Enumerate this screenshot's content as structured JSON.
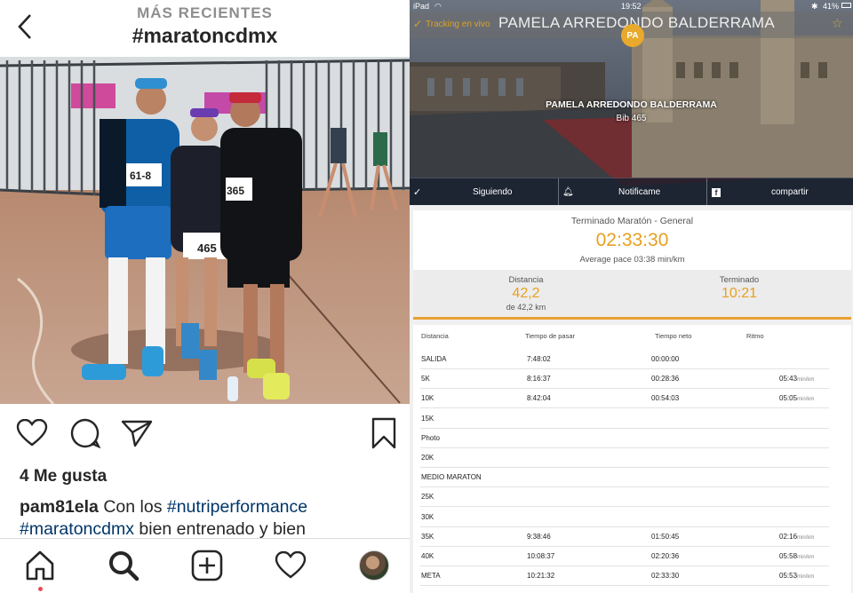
{
  "instagram": {
    "header": {
      "subtitle": "MÁS RECIENTES",
      "hashtag": "#maratoncdmx"
    },
    "photo": {
      "bib_left": "61-8",
      "bib_center": "465",
      "bib_right": "365"
    },
    "likes": "4 Me gusta",
    "caption": {
      "username": "pam81ela",
      "text1": " Con los ",
      "tag1": "#nutriperformance",
      "tag2": "#maratoncdmx",
      "text2": " bien entrenado y bien"
    }
  },
  "ipad": {
    "status": {
      "device": "iPad",
      "time": "19:52",
      "battery": "41%"
    },
    "tracking_label": "Tracking en vivo",
    "runner_name": "PAMELA ARREDONDO BALDERRAMA",
    "initials": "PA",
    "hero_name": "PAMELA ARREDONDO BALDERRAMA",
    "bib": "Bib 465",
    "actions": {
      "following": "Siguiendo",
      "notify": "Notificame",
      "share": "compartir"
    },
    "summary": {
      "title": "Terminado Maratón - General",
      "time": "02:33:30",
      "pace": "Average pace 03:38 min/km",
      "distance_label": "Distancia",
      "distance_value": "42,2",
      "distance_sub": "de 42,2 km",
      "finished_label": "Terminado",
      "finished_value": "10:21"
    },
    "table": {
      "headers": [
        "Distancia",
        "Tiempo de pasar",
        "Tiempo neto",
        "Ritmo"
      ],
      "unit": "min/km",
      "rows": [
        {
          "name": "SALIDA",
          "pass": "7:48:02",
          "net": "00:00:00",
          "pace": ""
        },
        {
          "name": "5K",
          "pass": "8:16:37",
          "net": "00:28:36",
          "pace": "05:43"
        },
        {
          "name": "10K",
          "pass": "8:42:04",
          "net": "00:54:03",
          "pace": "05:05"
        },
        {
          "name": "15K",
          "pass": "",
          "net": "",
          "pace": ""
        },
        {
          "name": "Photo",
          "pass": "",
          "net": "",
          "pace": ""
        },
        {
          "name": "20K",
          "pass": "",
          "net": "",
          "pace": ""
        },
        {
          "name": "MEDIO MARATON",
          "pass": "",
          "net": "",
          "pace": ""
        },
        {
          "name": "25K",
          "pass": "",
          "net": "",
          "pace": ""
        },
        {
          "name": "30K",
          "pass": "",
          "net": "",
          "pace": ""
        },
        {
          "name": "35K",
          "pass": "9:38:46",
          "net": "01:50:45",
          "pace": "02:16"
        },
        {
          "name": "40K",
          "pass": "10:08:37",
          "net": "02:20:36",
          "pace": "05:58"
        },
        {
          "name": "META",
          "pass": "10:21:32",
          "net": "02:33:30",
          "pace": "05:53"
        }
      ]
    }
  }
}
